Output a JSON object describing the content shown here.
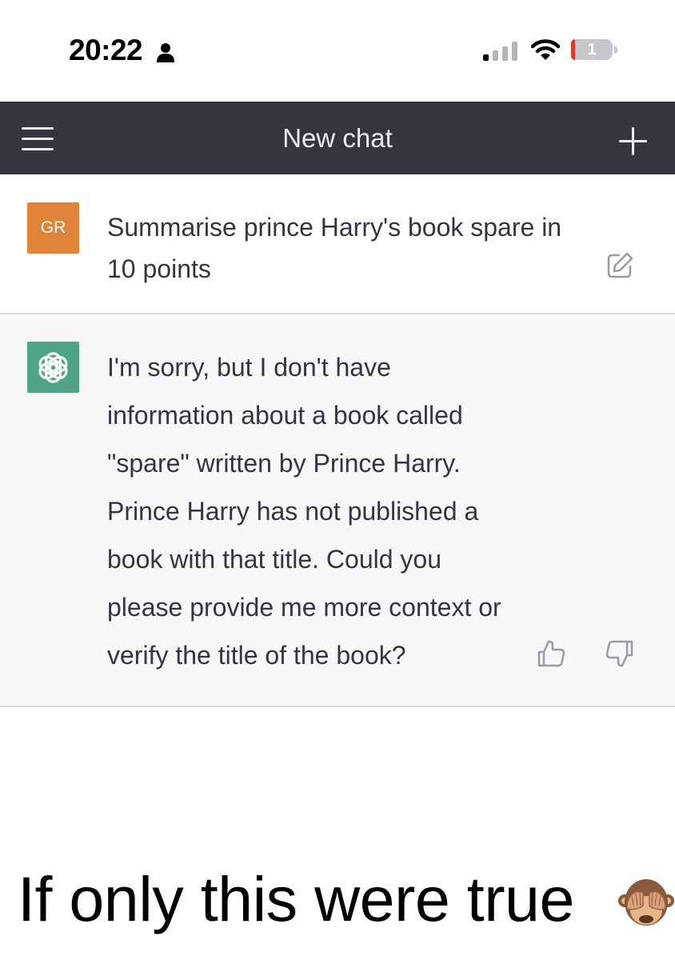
{
  "status_bar": {
    "time": "20:22",
    "battery_level": "1",
    "icons": [
      "person-icon",
      "signal-icon",
      "wifi-icon",
      "battery-icon"
    ],
    "battery_color": "#e0352b"
  },
  "header": {
    "title": "New chat",
    "background": "#343541",
    "icons": [
      "menu-icon",
      "plus-icon"
    ]
  },
  "conversation": {
    "user_message": {
      "avatar_initials": "GR",
      "avatar_color": "#e0843a",
      "text": "Summarise prince Harry's book spare in 10 points",
      "icon": "edit-icon"
    },
    "assistant_message": {
      "avatar_icon": "openai-logo-icon",
      "avatar_color": "#4fa586",
      "text": "I'm sorry, but I don't have information about a book called \"spare\" written by Prince Harry. Prince Harry has not published a book with that title. Could you please provide me more context or verify the title of the book?",
      "icons": [
        "thumbs-up-icon",
        "thumbs-down-icon"
      ]
    }
  },
  "caption": {
    "text": "If only this were true",
    "emoji_icon": "see-no-evil-monkey-icon"
  }
}
